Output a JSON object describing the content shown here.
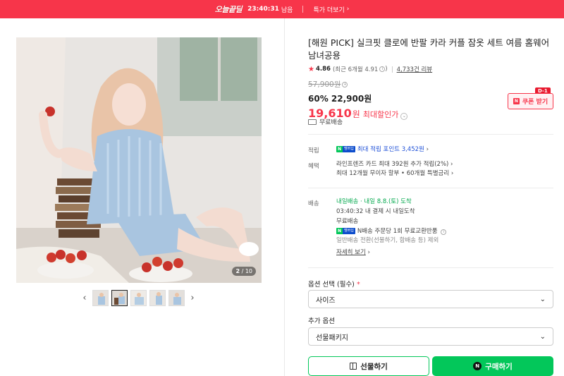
{
  "banner": {
    "logo": "오늘끝딜",
    "timer": "23:40:31",
    "remain": "남음",
    "more": "특가 더보기",
    "bg_color": "#f7354a"
  },
  "gallery": {
    "counter_current": "2",
    "counter_total": "/ 10",
    "prev_icon": "chevron-left",
    "next_icon": "chevron-right",
    "thumb_count": 5,
    "active_thumb": 2
  },
  "product": {
    "title": "[해원 PICK] 실크핏 클로에 반팔 카라 커플 잠옷 세트 여름 홈웨어 남녀공용",
    "rating": "4.86",
    "rating_recent": "(최근 6개월 4.91",
    "rating_recent_close": ")",
    "reviews": "4,733건 리뷰",
    "original_price": "57,900원",
    "discount_pct": "60%",
    "sale_price": "22,900원",
    "max_discount_value": "19,610",
    "max_discount_won": "원",
    "max_discount_label": "최대할인가",
    "coupon_label": "쿠폰 받기",
    "coupon_badge": "D-1",
    "shipping_free": "무료배송",
    "accent_color": "#f7354a",
    "npay_color": "#03c75a"
  },
  "points": {
    "label": "적립",
    "npay_n": "N",
    "npay_m": "멤버십",
    "text": "최대 적립 포인트 3,452원"
  },
  "benefits": {
    "label": "혜택",
    "line1": "라인프렌즈 카드 최대 392원 추가 적립(2%)",
    "line2": "최대 12개월 무이자 할부 • 60개월 특별금리"
  },
  "delivery": {
    "label": "배송",
    "badge": "내일배송",
    "arrival": "· 내일 8.8.(토) 도착",
    "deadline": "03:40:32  내 결제 시 내일도착",
    "free": "무료배송",
    "npay_return": "N배송 주문당 1회 무료교환반품",
    "exception": "일반배송 전환(선물하기, 함배송 등) 제외",
    "more": "자세히 보기"
  },
  "options": {
    "required_label": "옵션 선택 (필수)",
    "required_mark": "*",
    "size_placeholder": "사이즈",
    "extra_label": "추가 옵션",
    "extra_placeholder": "선물패키지"
  },
  "actions": {
    "gift": "선물하기",
    "buy": "구매하기",
    "buy_badge": "N"
  }
}
